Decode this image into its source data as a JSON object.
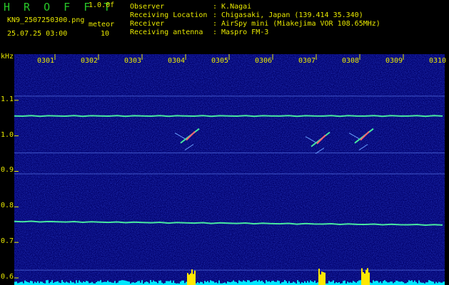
{
  "app": {
    "title": "H R O F F T",
    "version": "1.0.0f",
    "filename": "KN9_2507250300.png",
    "meteor_label": "meteor",
    "datetime": "25.07.25 03:00",
    "meteor_count": "10"
  },
  "info": {
    "observer_label": "Observer",
    "observer_value": ": K.Nagai",
    "location_label": "Receiving Location",
    "location_value": ": Chigasaki, Japan (139.414 35.340)",
    "receiver_label": "Receiver",
    "receiver_value": ": AirSpy mini (Miakejima VOR 108.65MHz)",
    "antenna_label": "Receiving antenna",
    "antenna_value": ": Maspro FM-3"
  },
  "colors": {
    "label": "#e8e800",
    "title": "#28c828",
    "background": "#00006a",
    "carrier": "#48e8a0",
    "meteor": "#ff6070",
    "histogram": "#00e8ff"
  },
  "chart_data": {
    "type": "heatmap",
    "ylabel": "kHz",
    "y_ticks": [
      "1.1",
      "1.0",
      "0.9",
      "0.8",
      "0.7",
      "0.6"
    ],
    "x_ticks": [
      "0301",
      "0302",
      "0303",
      "0304",
      "0305",
      "0306",
      "0307",
      "0308",
      "0309",
      "0310"
    ],
    "ylim": [
      0.58,
      1.23
    ],
    "carriers_khz": [
      1.056,
      0.755
    ],
    "faint_lines_khz": [
      1.112,
      0.952,
      0.893,
      0.622
    ],
    "meteors": [
      {
        "time": "0304",
        "freq_khz": 1.0
      },
      {
        "time": "0307",
        "freq_khz": 0.99
      },
      {
        "time": "0308",
        "freq_khz": 1.0
      }
    ]
  }
}
